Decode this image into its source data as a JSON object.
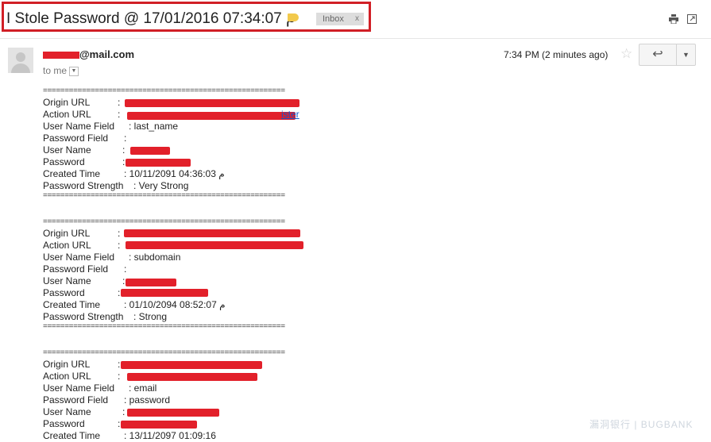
{
  "subject": {
    "title": "I Stole Password @ 17/01/2016 07:34:07 م",
    "label": "Inbox",
    "label_remove": "x"
  },
  "header_icons": {
    "print": "print-icon",
    "popout": "new-window-icon"
  },
  "message": {
    "sender_domain": "@mail.com",
    "recipient": "to me",
    "time": "7:34 PM (2 minutes ago)",
    "star": "☆",
    "reply": "↩",
    "more": "▼"
  },
  "separator": "========================================================",
  "records": [
    {
      "origin_label": "Origin URL",
      "origin_colon": ":",
      "action_label": "Action URL",
      "action_colon": ":",
      "user_field_label": "User Name Field",
      "user_field_value": ": last_name",
      "pass_field_label": "Password Field",
      "pass_field_value": ":",
      "user_label": "User Name",
      "user_value": ":",
      "pass_label": "Password",
      "pass_value": ":",
      "created_label": "Created Time",
      "created_value": ": 10/11/2091 04:36:03 م",
      "strength_label": "Password Strength",
      "strength_value": ": Very Strong"
    },
    {
      "origin_label": "Origin URL",
      "origin_colon": ":",
      "action_label": "Action URL",
      "action_colon": ":",
      "user_field_label": "User Name Field",
      "user_field_value": ": subdomain",
      "pass_field_label": "Password Field",
      "pass_field_value": ":",
      "user_label": "User Name",
      "user_value": ":",
      "pass_label": "Password",
      "pass_value": ":",
      "created_label": "Created Time",
      "created_value": ": 01/10/2094 08:52:07 م",
      "strength_label": "Password Strength",
      "strength_value": ": Strong"
    },
    {
      "origin_label": "Origin URL",
      "origin_colon": ":",
      "action_label": "Action URL",
      "action_colon": ":",
      "user_field_label": "User Name Field",
      "user_field_value": ": email",
      "pass_field_label": "Password Field",
      "pass_field_value": ": password",
      "user_label": "User Name",
      "user_value": ":",
      "pass_label": "Password",
      "pass_value": ":",
      "created_label": "Created Time",
      "created_value": ": 13/11/2097 01:09:16"
    }
  ],
  "watermark": "漏洞银行 | BUGBANK",
  "colors": {
    "highlight": "#d11f26",
    "redaction": "#e2202a",
    "link": "#1155cc",
    "label_tag": "#f2c94c"
  }
}
